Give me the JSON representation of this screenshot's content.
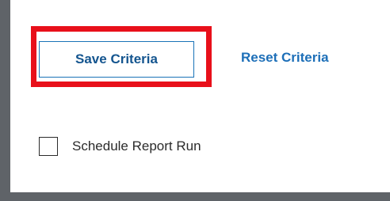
{
  "actions": {
    "save_label": "Save Criteria",
    "reset_label": "Reset Criteria"
  },
  "schedule": {
    "label": "Schedule Report Run",
    "checked": false
  },
  "colors": {
    "highlight": "#e8101a",
    "link": "#1d6fb8",
    "frame": "#5f6368"
  }
}
